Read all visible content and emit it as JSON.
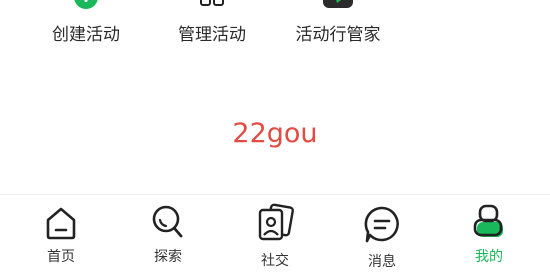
{
  "shortcuts": [
    {
      "label": "创建活动",
      "icon": "plus-circle-icon"
    },
    {
      "label": "管理活动",
      "icon": "grid-icon"
    },
    {
      "label": "活动行管家",
      "icon": "app-logo-icon"
    }
  ],
  "brand": {
    "text": "22gou",
    "color": "#e34b43"
  },
  "tabbar": {
    "accent_color": "#19b85a",
    "active_index": 4,
    "items": [
      {
        "label": "首页",
        "icon": "home-icon"
      },
      {
        "label": "探索",
        "icon": "search-icon"
      },
      {
        "label": "社交",
        "icon": "social-cards-icon"
      },
      {
        "label": "消息",
        "icon": "message-icon"
      },
      {
        "label": "我的",
        "icon": "profile-icon"
      }
    ]
  }
}
